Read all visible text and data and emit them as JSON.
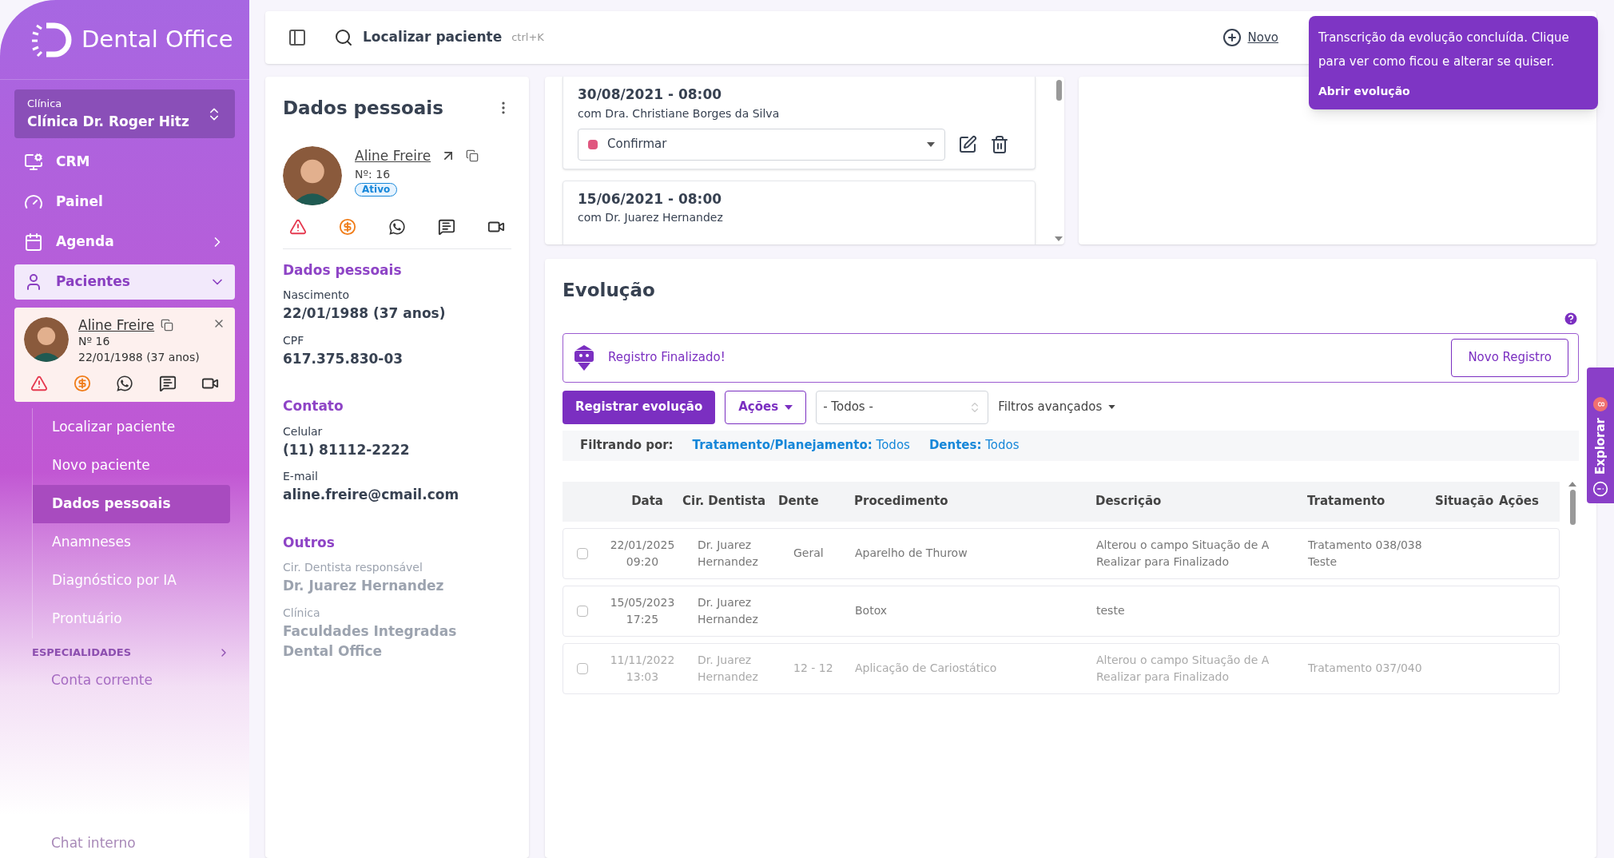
{
  "brand": {
    "name": "Dental Office"
  },
  "clinic": {
    "label": "Clínica",
    "value": "Clínica Dr. Roger Hitz"
  },
  "nav": [
    {
      "label": "CRM",
      "selected": false,
      "expanded": false
    },
    {
      "label": "Painel",
      "selected": false,
      "expanded": false
    },
    {
      "label": "Agenda",
      "selected": false,
      "expanded": false
    },
    {
      "label": "Pacientes",
      "selected": true,
      "expanded": true
    }
  ],
  "patient_card": {
    "name": "Aline Freire",
    "number": "Nº 16",
    "birth": "22/01/1988 (37 anos)"
  },
  "subnav": [
    {
      "label": "Localizar paciente",
      "selected": false
    },
    {
      "label": "Novo paciente",
      "selected": false
    },
    {
      "label": "Dados pessoais",
      "selected": true
    },
    {
      "label": "Anamneses",
      "selected": false
    },
    {
      "label": "Diagnóstico por IA",
      "selected": false
    },
    {
      "label": "Prontuário",
      "selected": false
    }
  ],
  "section_heading": "ESPECIALIDADES",
  "more_nav": [
    "Conta corrente",
    "Chat interno"
  ],
  "topbar": {
    "search": "Localizar paciente",
    "shortcut": "ctrl+K",
    "new": "Novo"
  },
  "toast": {
    "message": "Transcrição da evolução concluída. Clique para ver como ficou e alterar se quiser.",
    "action": "Abrir evolução"
  },
  "personal": {
    "title": "Dados pessoais",
    "name": "Aline Freire",
    "number": "Nº: 16",
    "status": "Ativo",
    "sections": [
      {
        "title": "Dados pessoais",
        "fields": [
          {
            "label": "Nascimento",
            "value": "22/01/1988 (37 anos)"
          },
          {
            "label": "CPF",
            "value": "617.375.830-03"
          }
        ]
      },
      {
        "title": "Contato",
        "fields": [
          {
            "label": "Celular",
            "value": "(11) 81112-2222"
          },
          {
            "label": "E-mail",
            "value": "aline.freire@cmail.com"
          }
        ]
      },
      {
        "title": "Outros",
        "fields": [
          {
            "label": "Cir. Dentista responsável",
            "value": "Dr. Juarez Hernandez"
          },
          {
            "label": "Clínica",
            "value": "Faculdades Integradas Dental Office"
          }
        ]
      }
    ]
  },
  "appointments": [
    {
      "when": "30/08/2021 - 08:00",
      "with": "com Dra. Christiane Borges da Silva",
      "status": "Confirmar",
      "color": "#e0577f"
    },
    {
      "when": "15/06/2021 - 08:00",
      "with": "com Dr. Juarez Hernandez"
    }
  ],
  "evolution": {
    "title": "Evolução",
    "notice": "Registro Finalizado!",
    "new_record": "Novo Registro",
    "register": "Registrar evolução",
    "actions": "Ações",
    "filter_select": "- Todos -",
    "advanced": "Filtros avançados",
    "filter_label": "Filtrando por:",
    "filters": [
      {
        "key": "Tratamento/Planejamento:",
        "value": "Todos"
      },
      {
        "key": "Dentes:",
        "value": "Todos"
      }
    ],
    "columns": [
      "Data",
      "Cir. Dentista",
      "Dente",
      "Procedimento",
      "Descrição",
      "Tratamento",
      "Situação",
      "Ações"
    ],
    "rows": [
      {
        "checked": false,
        "date": "22/01/2025",
        "time": "09:20",
        "dentist": "Dr. Juarez Hernandez",
        "tooth": "Geral",
        "procedure": "Aparelho de Thurow",
        "description": "Alterou o campo Situação de A Realizar para Finalizado",
        "treatment": "Tratamento 038/038 Teste"
      },
      {
        "checked": false,
        "date": "15/05/2023",
        "time": "17:25",
        "dentist": "Dr. Juarez Hernandez",
        "procedure": "Botox",
        "description": "teste"
      },
      {
        "checked": false,
        "date": "11/11/2022",
        "time": "13:03",
        "dentist": "Dr. Juarez Hernandez",
        "tooth": "12 - 12",
        "procedure": "Aplicação de Cariostático",
        "description": "Alterou o campo Situação de A Realizar para Finalizado",
        "treatment": "Tratamento 037/040"
      }
    ]
  },
  "explore": {
    "label": "Explorar",
    "badge": "8"
  }
}
